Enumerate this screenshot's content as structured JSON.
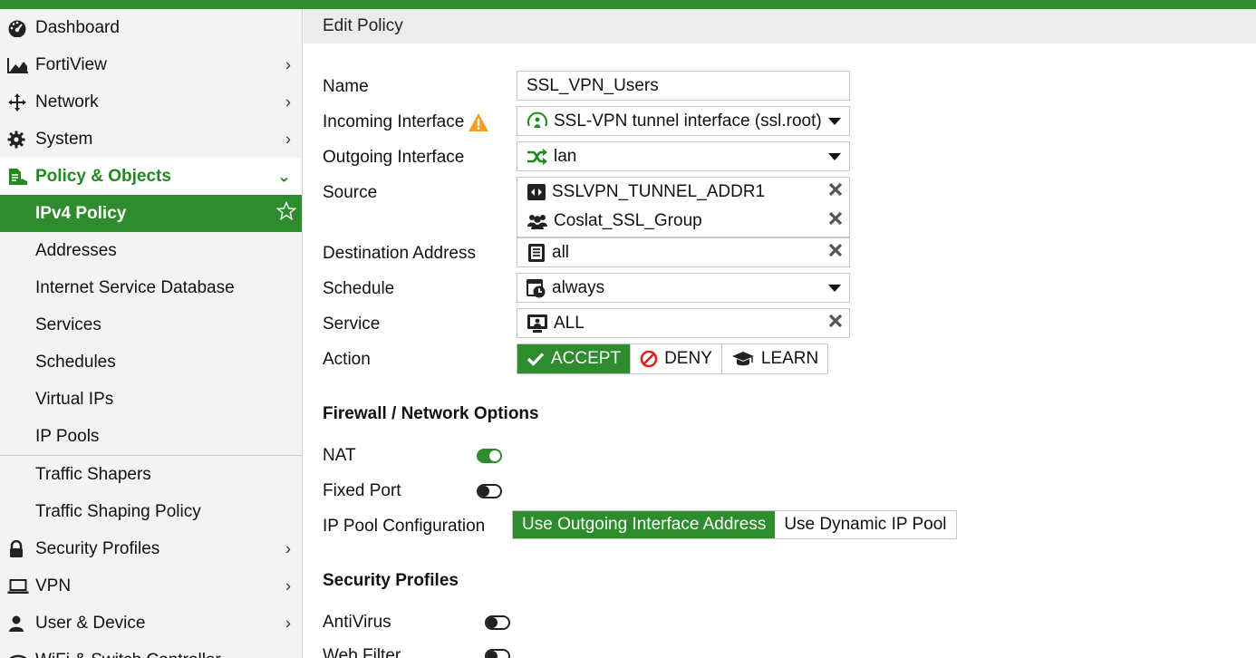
{
  "sidebar": {
    "items": [
      {
        "label": "Dashboard",
        "icon": "dashboard-icon"
      },
      {
        "label": "FortiView",
        "icon": "area-chart-icon"
      },
      {
        "label": "Network",
        "icon": "network-arrows-icon"
      },
      {
        "label": "System",
        "icon": "gear-icon"
      },
      {
        "label": "Policy & Objects",
        "icon": "policy-icon"
      },
      {
        "label": "IPv4 Policy"
      },
      {
        "label": "Addresses"
      },
      {
        "label": "Internet Service Database"
      },
      {
        "label": "Services"
      },
      {
        "label": "Schedules"
      },
      {
        "label": "Virtual IPs"
      },
      {
        "label": "IP Pools"
      },
      {
        "label": "Traffic Shapers"
      },
      {
        "label": "Traffic Shaping Policy"
      },
      {
        "label": "Security Profiles",
        "icon": "lock-icon"
      },
      {
        "label": "VPN",
        "icon": "laptop-icon"
      },
      {
        "label": "User & Device",
        "icon": "user-icon"
      },
      {
        "label": "WiFi & Switch Controller",
        "icon": "wifi-icon"
      }
    ]
  },
  "page": {
    "title": "Edit Policy"
  },
  "form": {
    "name_label": "Name",
    "name_value": "SSL_VPN_Users",
    "incoming_label": "Incoming Interface",
    "incoming_value": "SSL-VPN tunnel interface (ssl.root)",
    "outgoing_label": "Outgoing Interface",
    "outgoing_value": "lan",
    "source_label": "Source",
    "source_values": [
      "SSLVPN_TUNNEL_ADDR1",
      "Coslat_SSL_Group"
    ],
    "destination_label": "Destination Address",
    "destination_value": "all",
    "schedule_label": "Schedule",
    "schedule_value": "always",
    "service_label": "Service",
    "service_value": "ALL",
    "action_label": "Action",
    "action_options": [
      "ACCEPT",
      "DENY",
      "LEARN"
    ],
    "action_selected": "ACCEPT"
  },
  "firewall": {
    "section_title": "Firewall / Network Options",
    "nat_label": "NAT",
    "nat_on": true,
    "fixed_port_label": "Fixed Port",
    "fixed_port_on": false,
    "ip_pool_label": "IP Pool Configuration",
    "ip_pool_options": [
      "Use Outgoing Interface Address",
      "Use Dynamic IP Pool"
    ],
    "ip_pool_selected": "Use Outgoing Interface Address"
  },
  "security": {
    "section_title": "Security Profiles",
    "antivirus_label": "AntiVirus",
    "antivirus_on": false,
    "webfilter_label": "Web Filter",
    "webfilter_on": false
  },
  "colors": {
    "accent": "#2e8b2e",
    "warning": "#f0a020",
    "deny": "#e02020"
  }
}
